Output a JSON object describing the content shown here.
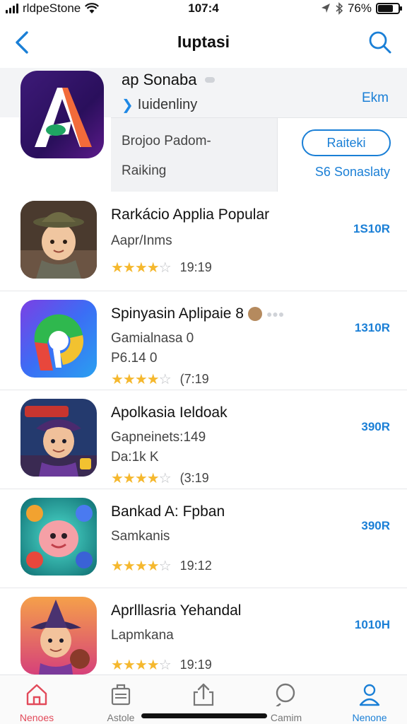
{
  "status_bar": {
    "carrier": "rldpeStone",
    "time": "107:4",
    "battery": "76%",
    "battery_level": 0.76
  },
  "nav": {
    "title": "Iuptasi"
  },
  "featured": {
    "name": "ap Sonaba",
    "subtitle": "Iuidenliny",
    "link": "Ekm",
    "line1": "Brojoo Padom-",
    "line2": "Raiking",
    "button": "Raiteki",
    "size": "S6 Sonaslaty"
  },
  "apps": [
    {
      "title": "Rarkácio Applia Popular",
      "line1": "Aapr/Inms",
      "line2": "",
      "rating_value": 4,
      "rating_count": "19:19",
      "price": "1S10R"
    },
    {
      "title": "Spinyasin Aplipaie 8",
      "line1": "Gamialnasa 0",
      "line2": "P6.14 0",
      "rating_value": 4,
      "rating_count": "(7:19",
      "price": "1310R"
    },
    {
      "title": "Apolkasia Ieldoak",
      "line1": "Gapneinets:149",
      "line2": "Da:1k K",
      "rating_value": 4,
      "rating_count": "(3:19",
      "price": "390R"
    },
    {
      "title": "Bankad A: Fpban",
      "line1": "Samkanis",
      "line2": "",
      "rating_value": 4,
      "rating_count": "19:12",
      "price": "390R"
    },
    {
      "title": "Aprlllasria Yehandal",
      "line1": "Lapmkana",
      "line2": "",
      "rating_value": 4,
      "rating_count": "19:19",
      "price": "1010H"
    }
  ],
  "tabs": [
    {
      "label": "Nenoes",
      "icon": "home-icon"
    },
    {
      "label": "Astole",
      "icon": "briefcase-icon"
    },
    {
      "label": "",
      "icon": "share-icon"
    },
    {
      "label": "Camim",
      "icon": "search-icon"
    },
    {
      "label": "Nenone",
      "icon": "person-icon"
    }
  ],
  "colors": {
    "accent": "#1a7fd6",
    "star": "#f5b82e",
    "active_tab": "#e24a5a"
  }
}
